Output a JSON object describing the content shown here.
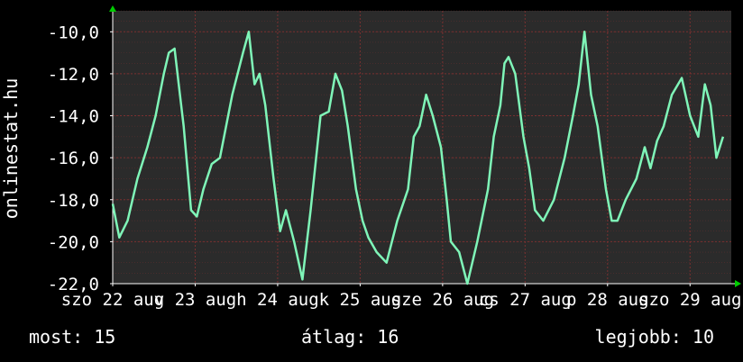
{
  "chart_data": {
    "type": "line",
    "ylabel": "onlinestat.hu",
    "ylim": [
      -22,
      -9
    ],
    "yticks": [
      -22,
      -20,
      -18,
      -16,
      -14,
      -12,
      -10
    ],
    "ytick_labels": [
      "-22,0",
      "-20,0",
      "-18,0",
      "-16,0",
      "-14,0",
      "-12,0",
      "-10,0"
    ],
    "xlim": [
      0,
      7.5
    ],
    "xticks": [
      0,
      1,
      2,
      3,
      4,
      5,
      6,
      7
    ],
    "xtick_labels": [
      "szo 22 aug",
      "v 23 aug",
      "h 24 aug",
      "k 25 aug",
      "sze 26 aug",
      "cs 27 aug",
      "p 28 aug",
      "szo 29 aug"
    ],
    "grid": true,
    "colors": {
      "background": "#000000",
      "plot_area": "#2b2b2b",
      "grid": "#7a3030",
      "line": "#7ff5b8",
      "axis": "#ffffff",
      "arrow": "#00cc00"
    },
    "series": [
      {
        "x": [
          0,
          0.08,
          0.18,
          0.3,
          0.42,
          0.52,
          0.62,
          0.68,
          0.75,
          0.8,
          0.86,
          0.95,
          1.02,
          1.1,
          1.2,
          1.3,
          1.45,
          1.58,
          1.65,
          1.72,
          1.78,
          1.85,
          1.95,
          2.03,
          2.1,
          2.2,
          2.3,
          2.4,
          2.52,
          2.62,
          2.7,
          2.78,
          2.85,
          2.95,
          3.03,
          3.1,
          3.2,
          3.32,
          3.45,
          3.58,
          3.65,
          3.72,
          3.8,
          3.88,
          3.98,
          4.05,
          4.1,
          4.2,
          4.3,
          4.42,
          4.55,
          4.62,
          4.7,
          4.75,
          4.8,
          4.88,
          4.98,
          5.05,
          5.12,
          5.22,
          5.35,
          5.48,
          5.58,
          5.65,
          5.72,
          5.8,
          5.88,
          5.98,
          6.05,
          6.12,
          6.22,
          6.35,
          6.45,
          6.52,
          6.6,
          6.68,
          6.78,
          6.9,
          7.0,
          7.1,
          7.18,
          7.25,
          7.32,
          7.4
        ],
        "y": [
          -18.2,
          -19.8,
          -19.0,
          -17.0,
          -15.5,
          -14.0,
          -12.0,
          -11.0,
          -10.8,
          -12.5,
          -14.5,
          -18.5,
          -18.8,
          -17.5,
          -16.3,
          -16.0,
          -13.0,
          -11.0,
          -10.0,
          -12.5,
          -12.0,
          -13.5,
          -17.0,
          -19.5,
          -18.5,
          -20.0,
          -21.8,
          -18.5,
          -14.0,
          -13.8,
          -12.0,
          -12.8,
          -14.5,
          -17.5,
          -19.0,
          -19.8,
          -20.5,
          -21.0,
          -19.0,
          -17.5,
          -15.0,
          -14.5,
          -13.0,
          -14.0,
          -15.5,
          -18.0,
          -20.0,
          -20.5,
          -22.0,
          -20.0,
          -17.5,
          -15.0,
          -13.5,
          -11.5,
          -11.2,
          -12.0,
          -15.0,
          -16.5,
          -18.5,
          -19.0,
          -18.0,
          -16.0,
          -14.0,
          -12.5,
          -10.0,
          -13.0,
          -14.5,
          -17.5,
          -19.0,
          -19.0,
          -18.0,
          -17.0,
          -15.5,
          -16.5,
          -15.2,
          -14.5,
          -13.0,
          -12.2,
          -14.0,
          -15.0,
          -12.5,
          -13.5,
          -16.0,
          -15.0
        ]
      }
    ]
  },
  "footer": {
    "most": "most: 15",
    "atlag": "átlag: 16",
    "legjobb": "legjobb: 10"
  }
}
